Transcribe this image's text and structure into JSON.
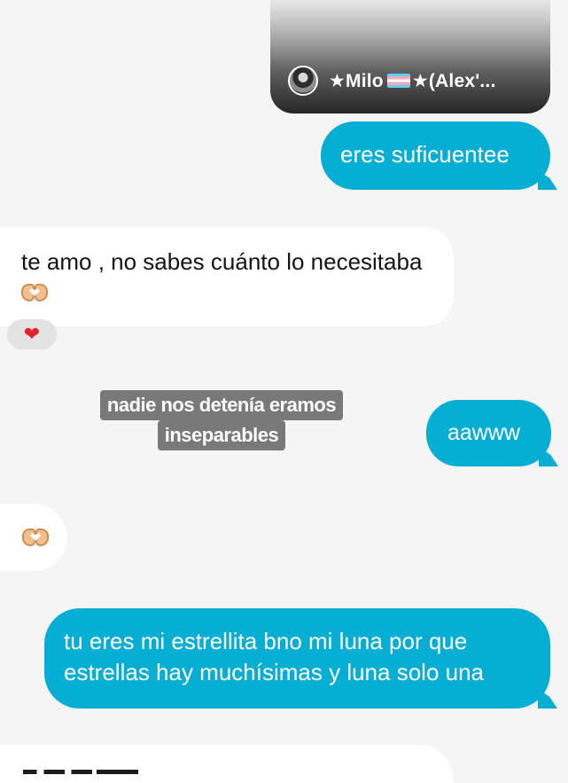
{
  "shared_post": {
    "owner_name_prefix": "★Milo",
    "owner_name_suffix": "★(Alex'..."
  },
  "messages": {
    "m1": "eres suficuentee",
    "m2": "te amo , no sabes cuánto lo necesitaba",
    "m2_reaction": "❤",
    "m3": "aawww",
    "m5": "tu eres mi estrellita bno mi luna por que estrellas hay muchísimas y luna solo una"
  },
  "caption": {
    "line1": "nadie nos detenía eramos",
    "line2": "inseparables"
  },
  "colors": {
    "sent_bubble": "#06aed4",
    "received_bubble": "#ffffff",
    "background": "#f5f5f5",
    "caption_bg": "#6e6e6e"
  },
  "icons": {
    "reaction": "heart-icon",
    "emoji": "heart-hands-icon",
    "flag": "transgender-flag-icon"
  }
}
